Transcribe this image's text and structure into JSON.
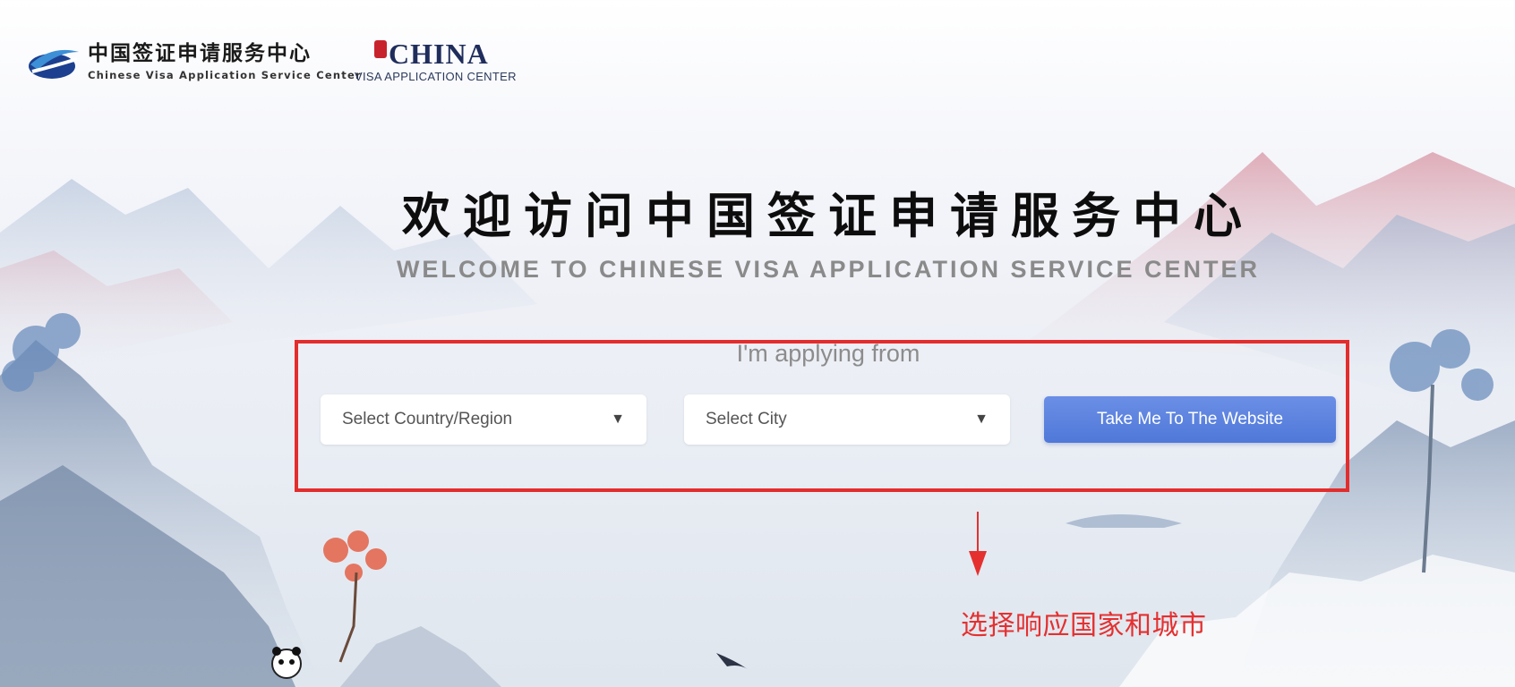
{
  "header": {
    "logo_cn": "中国签证申请服务中心",
    "logo_en": "Chinese Visa Application Service Center",
    "china_logo_word": "CHINA",
    "china_logo_sub": "VISA APPLICATION CENTER"
  },
  "hero": {
    "title_cn": "欢迎访问中国签证申请服务中心",
    "title_en": "WELCOME TO CHINESE VISA APPLICATION SERVICE CENTER"
  },
  "form": {
    "applying_label": "I'm applying from",
    "country_select": "Select Country/Region",
    "city_select": "Select City",
    "submit_label": "Take Me To The Website"
  },
  "annotation": {
    "text": "选择响应国家和城市",
    "color": "#e53030"
  },
  "icons": {
    "caret": "▼",
    "logo_mark": "swoosh-logo-icon",
    "arrow": "down-arrow-icon"
  },
  "colors": {
    "button": "#5a7fdc",
    "highlight": "#e32d2d",
    "brand_navy": "#1f2d5c"
  }
}
